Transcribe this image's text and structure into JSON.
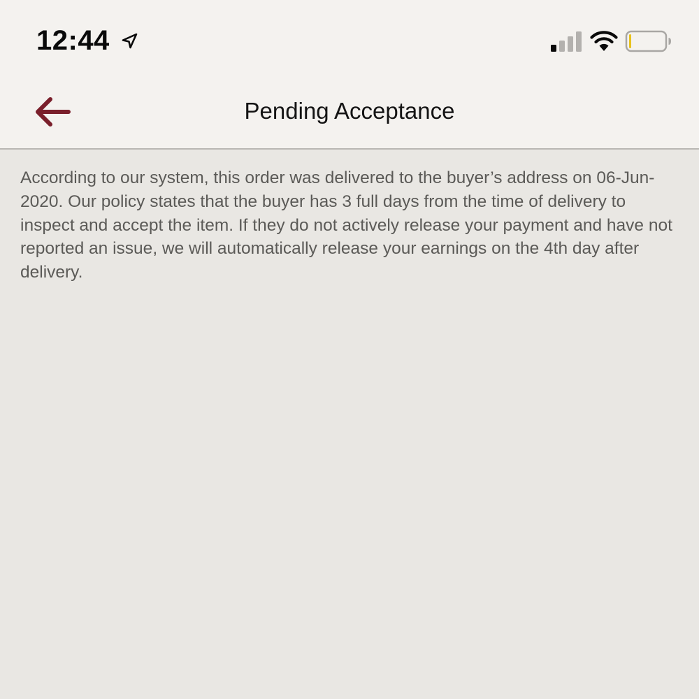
{
  "status_bar": {
    "time": "12:44",
    "icons": {
      "location": "location-arrow-icon",
      "signal": "cellular-signal-icon",
      "wifi": "wifi-icon",
      "battery": "battery-icon"
    },
    "signal_bars_active": 1,
    "signal_bars_total": 4,
    "battery_level": 0.05
  },
  "nav": {
    "title": "Pending Acceptance",
    "back_icon": "back-arrow-icon"
  },
  "content": {
    "message": "According to our system, this order was delivered to the buyer’s address on 06-Jun-2020. Our policy states that the buyer has 3 full days from the time of delivery to inspect and accept the item. If they do not actively release your payment and have not reported an issue, we will automatically release your earnings on the 4th day after delivery."
  },
  "colors": {
    "accent": "#7a1f2b",
    "header_bg": "#f4f2ef",
    "body_bg": "#e9e7e3",
    "body_text": "#5b5a57",
    "title_text": "#141414",
    "battery_low": "#e8c21c"
  }
}
